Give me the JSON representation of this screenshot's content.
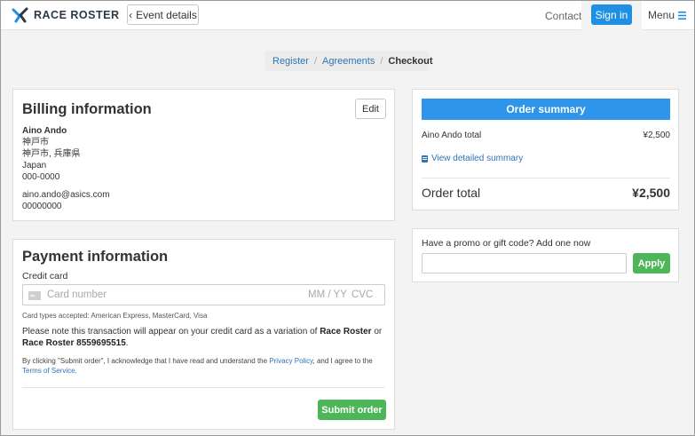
{
  "header": {
    "logo_text": "RACE ROSTER",
    "back_label": "Event details",
    "contact_label": "Contact",
    "signin_label": "Sign in",
    "menu_label": "Menu"
  },
  "breadcrumb": {
    "items": [
      "Register",
      "Agreements",
      "Checkout"
    ]
  },
  "billing": {
    "title": "Billing information",
    "edit_label": "Edit",
    "name": "Aino Ando",
    "address_line1": "神戸市",
    "address_line2": "神戸市, 兵庫県",
    "country": "Japan",
    "postal": "000-0000",
    "email": "aino.ando@asics.com",
    "phone": "00000000"
  },
  "payment": {
    "title": "Payment information",
    "card_label": "Credit card",
    "card_number_placeholder": "Card number",
    "expiry_placeholder": "MM / YY",
    "cvc_placeholder": "CVC",
    "accepted_text": "Card types accepted: American Express, MasterCard, Visa",
    "note_prefix": "Please note this transaction will appear on your credit card as a variation of ",
    "note_merchant1": "Race Roster",
    "note_or": " or",
    "note_merchant2": "Race Roster 8559695515",
    "note_suffix": ".",
    "terms_prefix": "By clicking \"Submit order\", I acknowledge that I have read and understand the ",
    "privacy_link": "Privacy Policy",
    "terms_middle": ", and I agree to the ",
    "terms_link": "Terms of Service",
    "terms_suffix": ".",
    "submit_label": "Submit order"
  },
  "summary": {
    "title": "Order summary",
    "line_label": "Aino Ando total",
    "line_amount": "¥2,500",
    "detail_link": "View detailed summary",
    "total_label": "Order total",
    "total_amount": "¥2,500"
  },
  "promo": {
    "label": "Have a promo or gift code? Add one now",
    "input_value": "",
    "apply_label": "Apply"
  },
  "colors": {
    "primary_blue": "#2e95ea",
    "success_green": "#4db659",
    "link_blue": "#2f74b5"
  }
}
